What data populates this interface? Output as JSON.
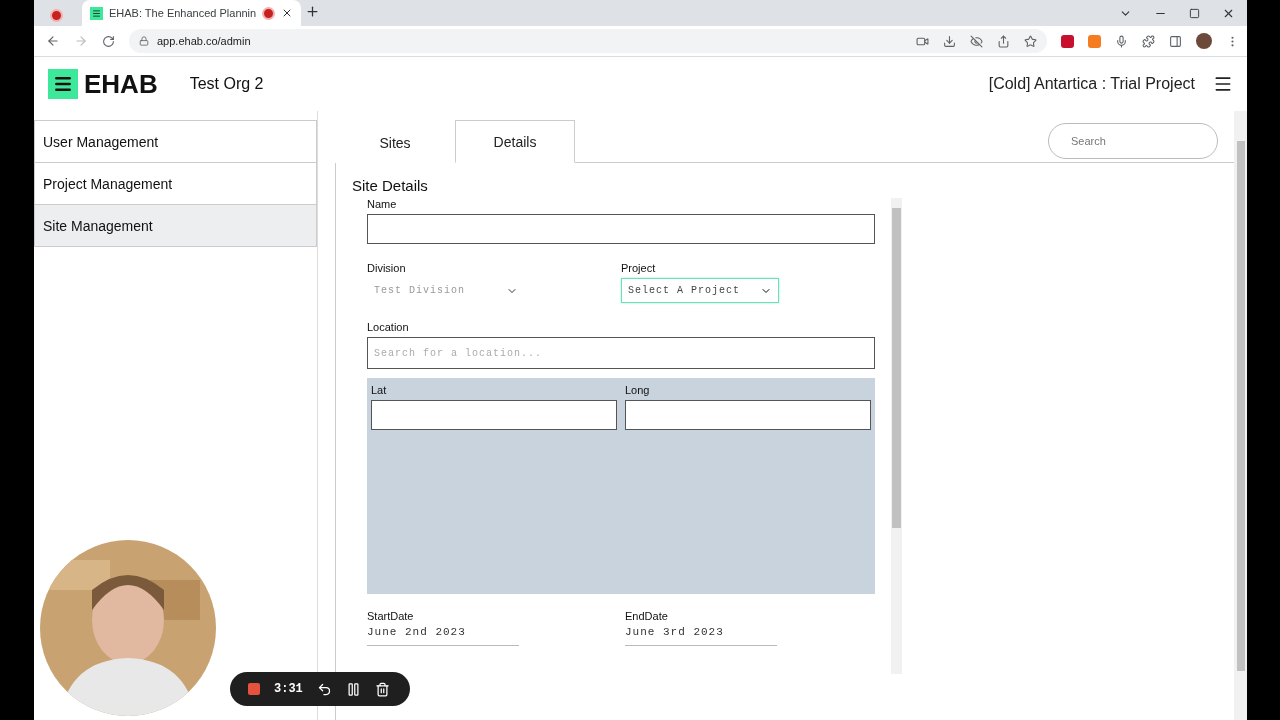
{
  "browser": {
    "tabs": [
      {
        "kind": "recording",
        "selected": false
      },
      {
        "kind": "page",
        "title": "EHAB: The Enhanced Plannin",
        "selected": true
      }
    ],
    "url": "app.ehab.co/admin"
  },
  "header": {
    "brand": "EHAB",
    "org": "Test Org 2",
    "project": "[Cold] Antartica : Trial Project"
  },
  "sidebar": {
    "items": [
      {
        "label": "User Management",
        "selected": false
      },
      {
        "label": "Project Management",
        "selected": false
      },
      {
        "label": "Site Management",
        "selected": true
      }
    ]
  },
  "tabs": [
    {
      "label": "Sites",
      "selected": false
    },
    {
      "label": "Details",
      "selected": true
    }
  ],
  "search": {
    "placeholder": "Search"
  },
  "form": {
    "title": "Site Details",
    "name": {
      "label": "Name"
    },
    "division": {
      "label": "Division",
      "value": "Test Division",
      "disabled": true
    },
    "project": {
      "label": "Project",
      "value": "Select A Project",
      "focused": true
    },
    "location": {
      "label": "Location",
      "placeholder": "Search for a location..."
    },
    "lat": {
      "label": "Lat"
    },
    "long": {
      "label": "Long"
    },
    "start": {
      "label": "StartDate",
      "value": "June 2nd 2023"
    },
    "end": {
      "label": "EndDate",
      "value": "June 3rd 2023"
    }
  },
  "recorder": {
    "time": "3:31"
  }
}
